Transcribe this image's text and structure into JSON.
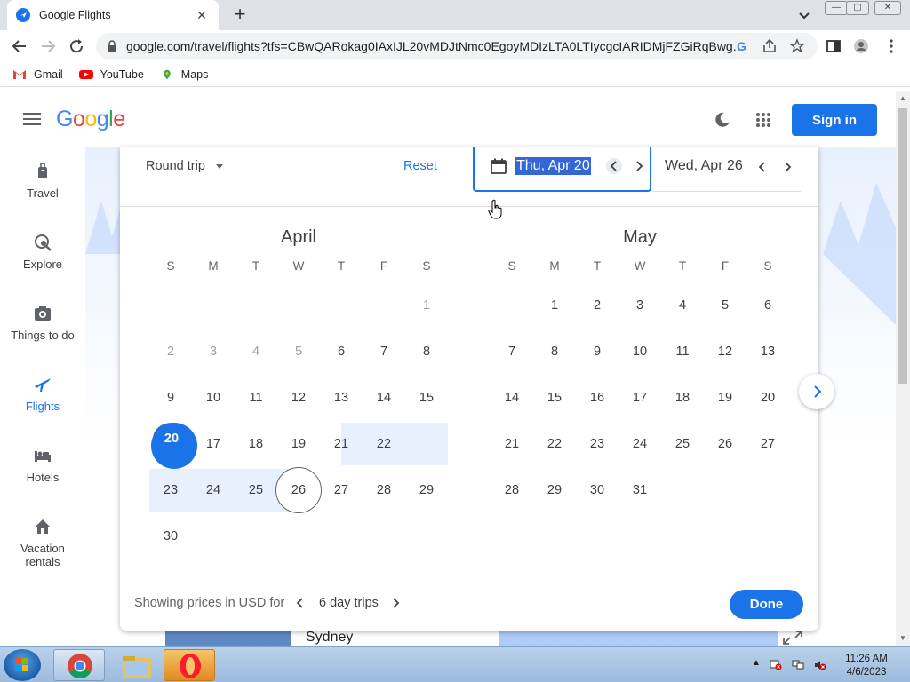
{
  "browser": {
    "tab_title": "Google Flights",
    "url": "google.com/travel/flights?tfs=CBwQARokag0IAxIJL20vMDJtNmc0EgoyMDIzLTA0LTIycgcIARIDMjFZGiRqBwg...",
    "bookmarks": [
      {
        "label": "Gmail",
        "icon": "gmail-icon"
      },
      {
        "label": "YouTube",
        "icon": "youtube-icon"
      },
      {
        "label": "Maps",
        "icon": "maps-icon"
      }
    ]
  },
  "header": {
    "logo": "Google",
    "sign_in": "Sign in"
  },
  "sidenav": [
    {
      "label": "Travel",
      "icon": "suitcase-icon"
    },
    {
      "label": "Explore",
      "icon": "explore-icon"
    },
    {
      "label": "Things to do",
      "icon": "camera-icon"
    },
    {
      "label": "Flights",
      "icon": "plane-icon",
      "active": true
    },
    {
      "label": "Hotels",
      "icon": "bed-icon"
    },
    {
      "label": "Vacation",
      "label2": "rentals",
      "icon": "house-icon"
    }
  ],
  "popup": {
    "trip_type": "Round trip",
    "reset": "Reset",
    "depart_date": "Thu, Apr 20",
    "return_date": "Wed, Apr 26",
    "weekdays": [
      "S",
      "M",
      "T",
      "W",
      "T",
      "F",
      "S"
    ],
    "months": [
      {
        "name": "April",
        "weeks": [
          [
            "",
            "",
            "",
            "",
            "",
            "",
            "1"
          ],
          [
            "2",
            "3",
            "4",
            "5",
            "6",
            "7",
            "8"
          ],
          [
            "9",
            "10",
            "11",
            "12",
            "13",
            "14",
            "15"
          ],
          [
            "16",
            "17",
            "18",
            "19",
            "20",
            "21",
            "22"
          ],
          [
            "23",
            "24",
            "25",
            "26",
            "27",
            "28",
            "29"
          ],
          [
            "30",
            "",
            "",
            "",
            "",
            "",
            ""
          ]
        ]
      },
      {
        "name": "May",
        "weeks": [
          [
            "",
            "1",
            "2",
            "3",
            "4",
            "5",
            "6"
          ],
          [
            "7",
            "8",
            "9",
            "10",
            "11",
            "12",
            "13"
          ],
          [
            "14",
            "15",
            "16",
            "17",
            "18",
            "19",
            "20"
          ],
          [
            "21",
            "22",
            "23",
            "24",
            "25",
            "26",
            "27"
          ],
          [
            "28",
            "29",
            "30",
            "31",
            "",
            "",
            ""
          ]
        ]
      }
    ],
    "showing": "Showing prices in USD for",
    "trip_length": "6 day trips",
    "done": "Done"
  },
  "background": {
    "card_city": "Sydney"
  },
  "taskbar": {
    "time": "11:26 AM",
    "date": "4/6/2023"
  },
  "colors": {
    "accent": "#1a73e8",
    "range": "#e8f0fe"
  }
}
